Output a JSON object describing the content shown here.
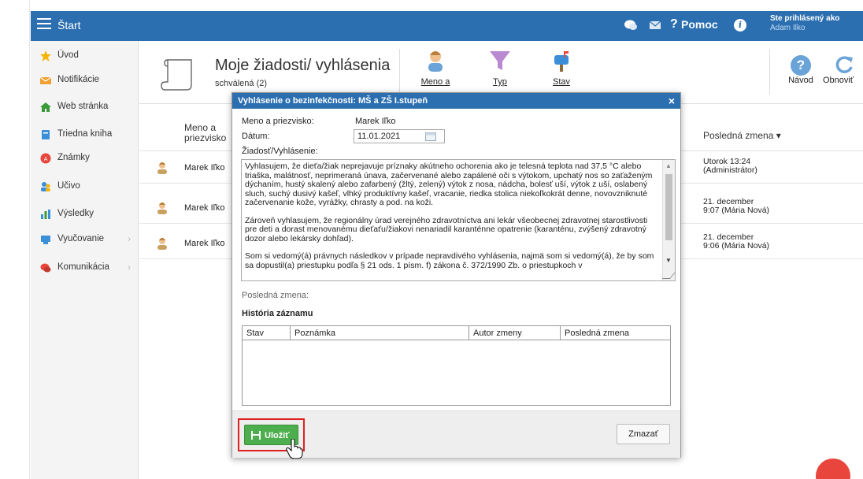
{
  "topbar": {
    "title": "Štart",
    "help_q": "?",
    "help_label": "Pomoc",
    "info_icon": "i",
    "logged_in_label": "Ste prihlásený ako",
    "user_name": "Adam Ilko"
  },
  "sidebar": {
    "items": [
      {
        "label": "Úvod",
        "icon": "star-icon",
        "color": "#f5b400"
      },
      {
        "label": "Notifikácie",
        "icon": "envelope-icon",
        "color": "#f0a030"
      },
      {
        "label": "Web stránka",
        "icon": "house-icon",
        "color": "#3a9a3a"
      },
      {
        "label": "Triedna kniha",
        "icon": "book-icon",
        "color": "#3b8fd9"
      },
      {
        "label": "Známky",
        "icon": "grade-icon",
        "color": "#e8453c"
      },
      {
        "label": "Učivo",
        "icon": "students-icon",
        "color": "#3b8fd9"
      },
      {
        "label": "Výsledky",
        "icon": "bar-chart-icon",
        "color": "#3b8fd9"
      },
      {
        "label": "Vyučovanie",
        "icon": "teaching-icon",
        "color": "#3b8fd9"
      },
      {
        "label": "Komunikácia",
        "icon": "chat-icon",
        "color": "#e8453c"
      }
    ]
  },
  "page": {
    "title": "Moje žiadosti/ vyhlásenia",
    "subtitle": "schválená (2)",
    "filters": [
      {
        "label": "Meno a",
        "icon": "person-filter-icon"
      },
      {
        "label": "Typ",
        "icon": "funnel-icon"
      },
      {
        "label": "Stav",
        "icon": "mailbox-icon"
      }
    ],
    "help_label": "Návod",
    "refresh_label": "Obnoviť"
  },
  "table": {
    "col_name_line1": "Meno a",
    "col_name_line2": "priezvisko",
    "col_last_change": "Posledná zmena ▾",
    "rows": [
      {
        "name": "Marek Iľko",
        "date_line1": "Utorok 13:24",
        "date_line2": "(Administrátor)"
      },
      {
        "name": "Marek Iľko",
        "date_line1": "21. december",
        "date_line2": "9:07 (Mária Nová)"
      },
      {
        "name": "Marek Iľko",
        "date_line1": "21. december",
        "date_line2": "9:06 (Mária Nová)"
      }
    ]
  },
  "modal": {
    "title": "Vyhlásenie o bezinfekčnosti: MŠ a ZŠ I.stupeň",
    "close": "×",
    "name_label": "Meno a priezvisko:",
    "name_value": "Marek Iľko",
    "date_label": "Dátum:",
    "date_value": "11.01.2021",
    "request_label": "Žiadosť/Vyhlásenie:",
    "request_p1": "Vyhlasujem, že dieťa/žiak neprejavuje príznaky akútneho ochorenia ako je telesná teplota nad 37,5 °C alebo triaška, malátnosť, neprimeraná únava, začervenané alebo zapálené oči s výtokom, upchatý nos so zaťaženým dýchaním, hustý skalený alebo zafarbený (žltý, zelený) výtok z nosa, nádcha, bolesť uší, výtok z uší, oslabený sluch, suchý dusivý kašeľ, vlhký produktívny kašeľ, vracanie, riedka stolica niekoľkokrát denne, novovzniknuté začervenanie kože, vyrážky, chrasty a pod. na koži.",
    "request_p2": "Zároveň vyhlasujem, že regionálny úrad verejného zdravotníctva ani lekár všeobecnej zdravotnej starostlivosti pre deti a dorast menovanému dieťaťu/žiakovi nenariadil karanténne opatrenie (karanténu, zvýšený zdravotný dozor alebo lekársky dohľad).",
    "request_p3": "Som si vedomý(á) právnych následkov v prípade nepravdivého vyhlásenia, najmä som si vedomý(á), že by som sa dopustil(a) priestupku podľa § 21 ods. 1 písm. f) zákona č. 372/1990 Zb. o priestupkoch v",
    "last_change_label": "Posledná zmena:",
    "history_label": "História záznamu",
    "history_cols": [
      "Stav",
      "Poznámka",
      "Autor zmeny",
      "Posledná zmena"
    ],
    "save_label": "Uložiť",
    "delete_label": "Zmazať"
  }
}
